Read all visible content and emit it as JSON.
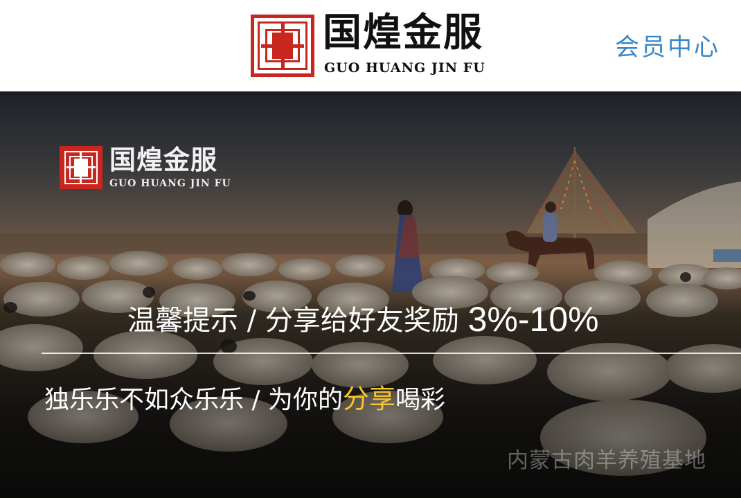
{
  "header": {
    "brand_cn": "国煌金服",
    "brand_en": "GUO HUANG JIN FU",
    "member_link": "会员中心"
  },
  "banner": {
    "logo_cn": "国煌金服",
    "logo_en": "GUO HUANG JIN FU",
    "tip_prefix": "温馨提示 / 分享给好友奖励 ",
    "tip_rate": "3%-10%",
    "slogan_prefix": "独乐乐不如众乐乐 / 为你的",
    "slogan_highlight": "分享",
    "slogan_suffix": "喝彩",
    "watermark": "内蒙古肉羊养殖基地"
  },
  "colors": {
    "brand_red": "#c8261f",
    "member_blue": "#3b86c9",
    "highlight_yellow": "#f4c62a"
  }
}
